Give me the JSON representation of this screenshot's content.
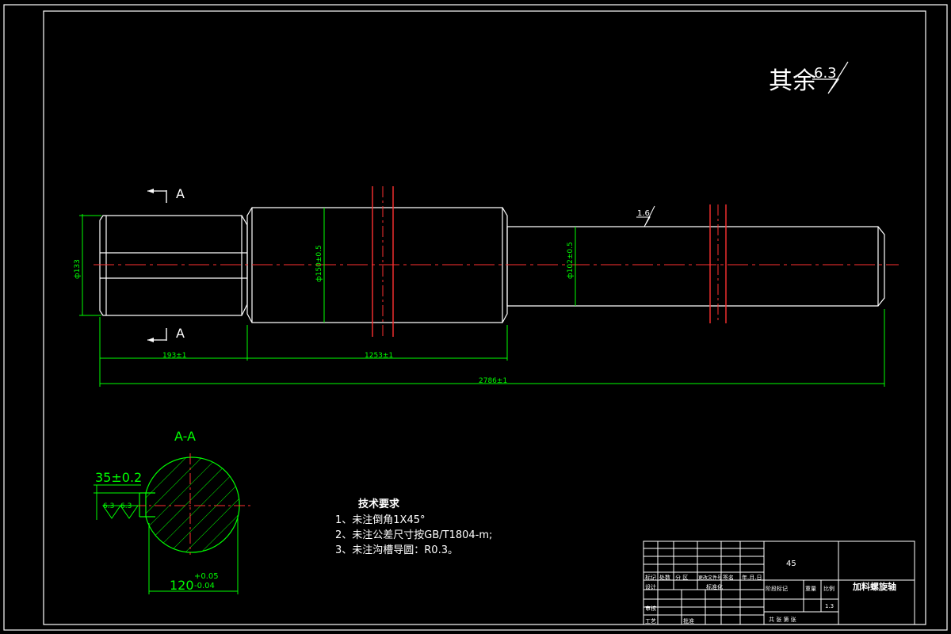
{
  "roughness_note": {
    "prefix": "其余",
    "value": "6.3"
  },
  "section_label_top": "A",
  "section_label_bottom": "A",
  "section_title": "A-A",
  "surface_finish_shaft": "1.6",
  "dims": {
    "d_left": "ф133",
    "d_mid": "ф150±0.5",
    "d_right": "ф102±0.5",
    "len_193": "193±1",
    "len_1253": "1253±1",
    "len_total": "2786±1",
    "keyway_depth": "35±0.2",
    "section_dia_base": "120",
    "section_dia_upper": "+0.05",
    "section_dia_lower": "-0.04",
    "key_finish_1": "6.3",
    "key_finish_2": "6.3"
  },
  "tech_req": {
    "title": "技术要求",
    "items": [
      "1、未注倒角1X45°",
      "2、未注公差尺寸按GB/T1804-m;",
      "3、未注沟槽导圆：R0.3。"
    ]
  },
  "title_block": {
    "material": "45",
    "part_name": "加料螺旋轴",
    "scale": "1.3",
    "labels": {
      "mark": "标记",
      "count": "处数",
      "zone": "分 区",
      "change_doc": "更改文件号",
      "sign": "签名",
      "date": "年.月.日",
      "design": "设计",
      "standardize": "标准化",
      "stage_mark": "阶段标记",
      "weight": "重量",
      "ratio": "比例",
      "review": "审核",
      "craft": "工艺",
      "approve": "批准",
      "sheets": "共   张   第   张"
    }
  }
}
